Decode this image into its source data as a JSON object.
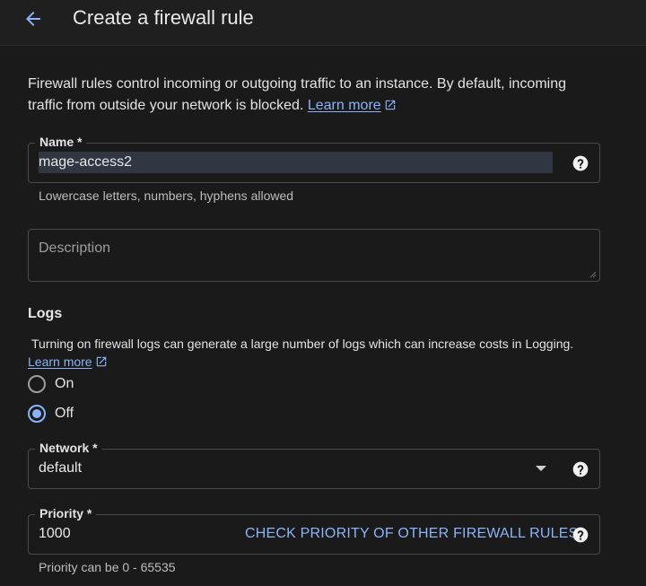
{
  "header": {
    "title": "Create a firewall rule"
  },
  "intro": {
    "text": "Firewall rules control incoming or outgoing traffic to an instance. By default, incoming traffic from outside your network is blocked.",
    "learn_more": "Learn more"
  },
  "name_field": {
    "label": "Name *",
    "value": "mage-access2",
    "hint": "Lowercase letters, numbers, hyphens allowed"
  },
  "description_field": {
    "placeholder": "Description"
  },
  "logs": {
    "title": "Logs",
    "description": "Turning on firewall logs can generate a large number of logs which can increase costs in Logging.",
    "learn_more": "Learn more",
    "options": [
      {
        "label": "On",
        "checked": false
      },
      {
        "label": "Off",
        "checked": true
      }
    ]
  },
  "network_field": {
    "label": "Network *",
    "value": "default"
  },
  "priority_field": {
    "label": "Priority *",
    "value": "1000",
    "check_button": "CHECK PRIORITY OF OTHER FIREWALL RULES",
    "hint": "Priority can be 0 - 65535"
  },
  "colors": {
    "accent": "#8ab4f8",
    "background": "#1a1a1a"
  },
  "icons": {
    "back": "arrow-left-icon",
    "external": "open-in-new-icon",
    "help": "help-icon",
    "dropdown": "chevron-down-icon"
  }
}
